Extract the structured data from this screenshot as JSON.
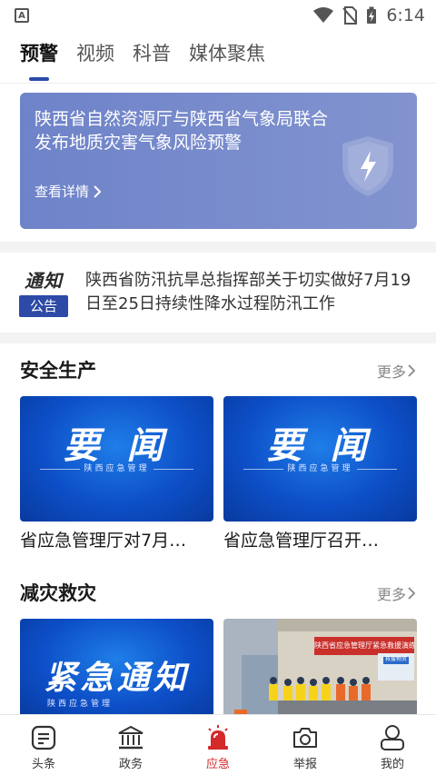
{
  "status_bar": {
    "time": "6:14",
    "app_icon_letter": "A"
  },
  "top_tabs": [
    {
      "label": "预警",
      "active": true
    },
    {
      "label": "视频",
      "active": false
    },
    {
      "label": "科普",
      "active": false
    },
    {
      "label": "媒体聚焦",
      "active": false
    }
  ],
  "warning_card": {
    "title": "陕西省自然资源厅与陕西省气象局联合发布地质灾害气象风险预警",
    "link_label": "查看详情",
    "icon": "lightning-shield-icon"
  },
  "notice": {
    "badge_top": "通知",
    "badge_bottom": "公告",
    "text": "陕西省防汛抗旱总指挥部关于切实做好7月19日至25日持续性降水过程防汛工作"
  },
  "sections": [
    {
      "title": "安全生产",
      "more_label": "更多",
      "items": [
        {
          "image_title": "要 闻",
          "image_sub": "陕西应急管理",
          "caption": "省应急管理厅对7月…"
        },
        {
          "image_title": "要 闻",
          "image_sub": "陕西应急管理",
          "caption": "省应急管理厅召开…"
        }
      ]
    },
    {
      "title": "减灾救灾",
      "more_label": "更多",
      "items": [
        {
          "image_title": "紧急通知",
          "image_sub": "陕西应急管理"
        },
        {
          "image_banner": "陕西省应急管理厅紧急救援演练",
          "image_board": "救援物资"
        }
      ]
    }
  ],
  "bottom_nav": [
    {
      "label": "头条",
      "icon": "headline-icon",
      "active": false
    },
    {
      "label": "政务",
      "icon": "government-building-icon",
      "active": false
    },
    {
      "label": "应急",
      "icon": "alarm-siren-icon",
      "active": true
    },
    {
      "label": "举报",
      "icon": "camera-icon",
      "active": false
    },
    {
      "label": "我的",
      "icon": "user-profile-icon",
      "active": false
    }
  ],
  "colors": {
    "accent_blue": "#2b4aa8",
    "card_blue": "#7486cb",
    "active_red": "#d42a2a"
  }
}
